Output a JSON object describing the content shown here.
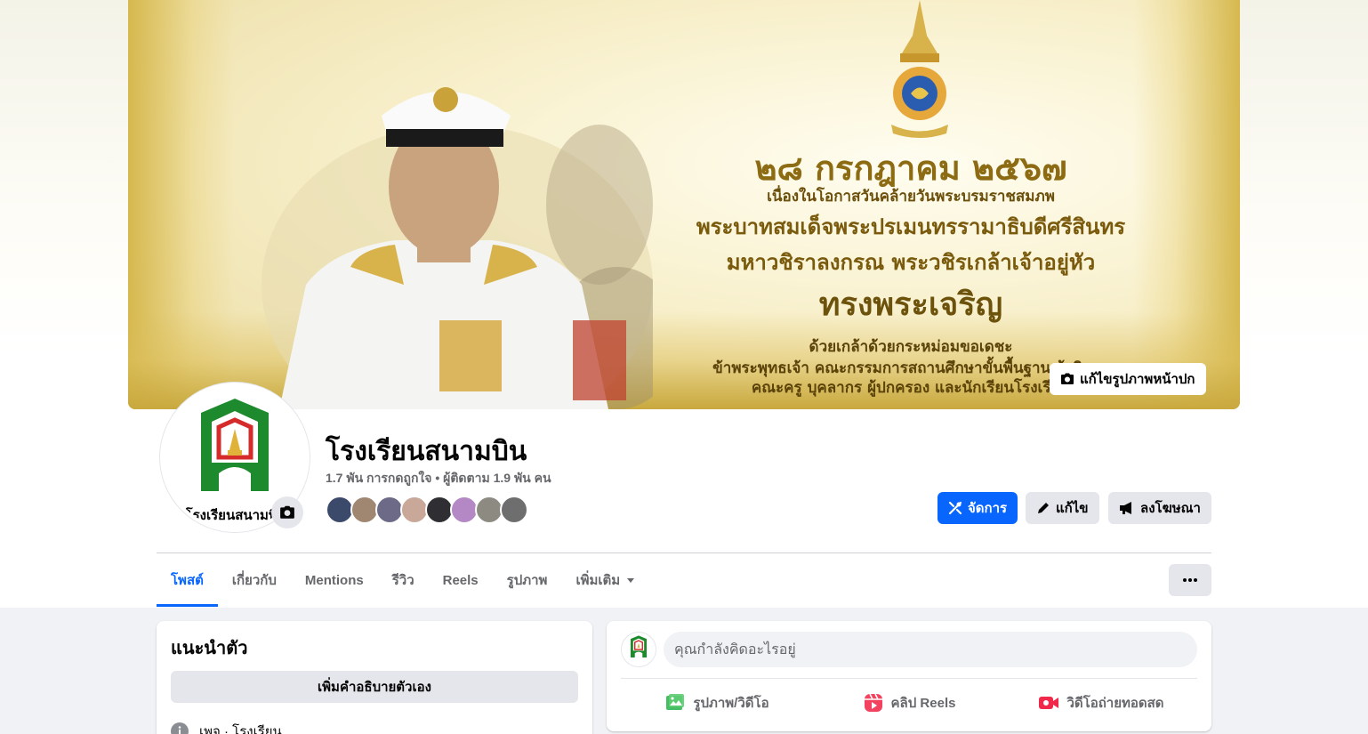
{
  "cover": {
    "date": "๒๘ กรกฎาคม ๒๕๖๗",
    "line1": "เนื่องในโอกาสวันคล้ายวันพระบรมราชสมภพ",
    "line2": "พระบาทสมเด็จพระปรเมนทรรามาธิบดีศรีสินทร",
    "line3": "มหาวชิราลงกรณ พระวชิรเกล้าเจ้าอยู่หัว",
    "line4": "ทรงพระเจริญ",
    "line5": "ด้วยเกล้าด้วยกระหม่อมขอเดชะ",
    "line6": "ข้าพระพุทธเจ้า คณะกรรมการสถานศึกษาขั้นพื้นฐาน ผู้บริหาร",
    "line7": "คณะครู บุคลากร ผู้ปกครอง และนักเรียนโรงเรียน",
    "edit_label": "แก้ไขรูปภาพหน้าปก"
  },
  "page": {
    "name": "โรงเรียนสนามบิน",
    "stats": "1.7 พัน การกดถูกใจ • ผู้ติดตาม 1.9 พัน คน",
    "logo_text": "โรงเรียนสนามบิ"
  },
  "actions": {
    "manage": "จัดการ",
    "edit": "แก้ไข",
    "ads": "ลงโฆษณา"
  },
  "tabs": [
    {
      "label": "โพสต์"
    },
    {
      "label": "เกี่ยวกับ"
    },
    {
      "label": "Mentions"
    },
    {
      "label": "รีวิว"
    },
    {
      "label": "Reels"
    },
    {
      "label": "รูปภาพ"
    },
    {
      "label": "เพิ่มเติม"
    }
  ],
  "intro": {
    "title": "แนะนำตัว",
    "add_bio": "เพิ่มคำอธิบายตัวเอง",
    "category": "เพจ · โรงเรียน"
  },
  "composer": {
    "placeholder": "คุณกำลังคิดอะไรอยู่",
    "photo": "รูปภาพ/วิดีโอ",
    "reels": "คลิป Reels",
    "live": "วิดีโอถ่ายทอดสด"
  },
  "colors": {
    "primary": "#0866ff",
    "logo_green": "#1e8a2e",
    "logo_red": "#d62b2b"
  }
}
